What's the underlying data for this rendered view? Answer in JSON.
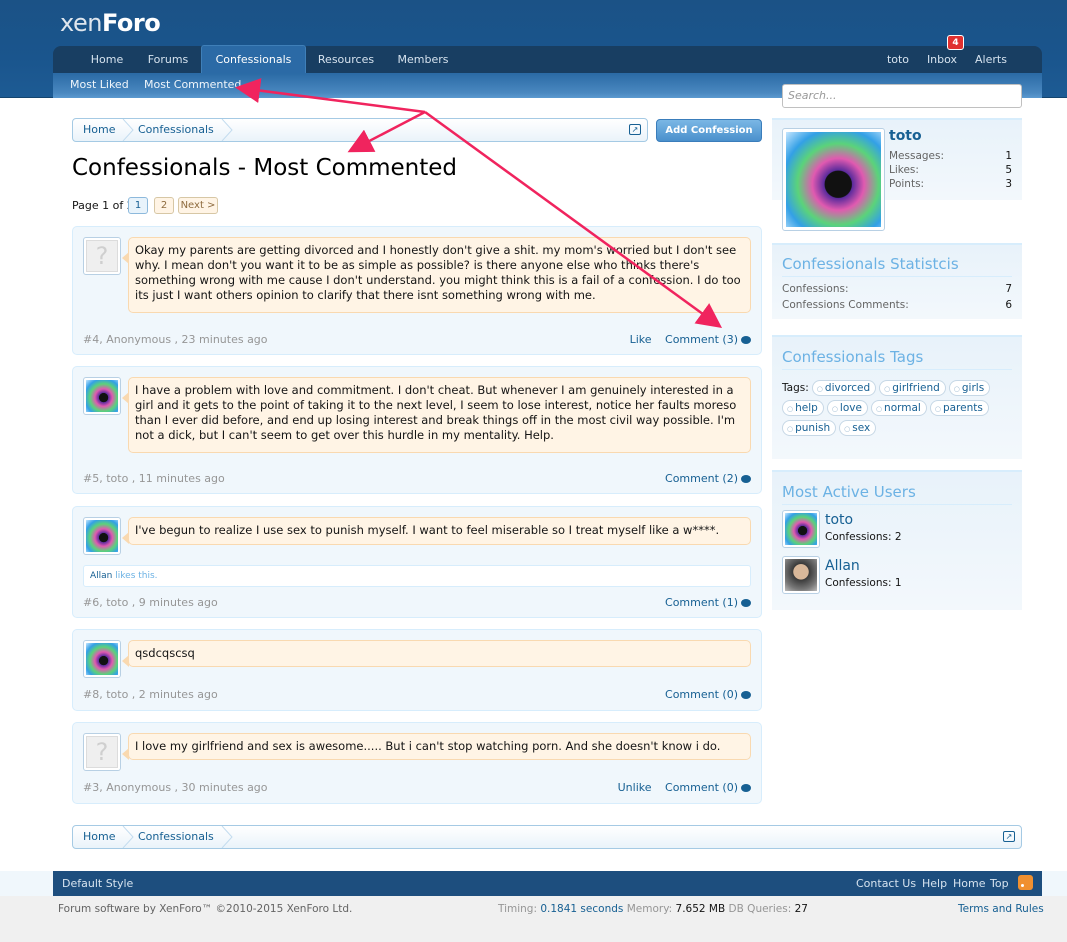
{
  "logo": {
    "xen": "xen",
    "foro": "Foro"
  },
  "nav": {
    "tabs": [
      "Home",
      "Forums",
      "Confessionals",
      "Resources",
      "Members"
    ],
    "user": "toto",
    "inbox": "Inbox",
    "inbox_count": "4",
    "alerts": "Alerts",
    "subtabs": [
      "Most Liked",
      "Most Commented"
    ]
  },
  "search": {
    "placeholder": "Search..."
  },
  "breadcrumb": [
    "Home",
    "Confessionals"
  ],
  "add_button": "Add Confession",
  "page_title": "Confessionals - Most Commented",
  "pagenav": {
    "label": "Page 1 of 2",
    "pages": [
      "1",
      "2"
    ],
    "next": "Next >"
  },
  "confessions": [
    {
      "text": "Okay my parents are getting divorced and I honestly don't give a shit. my mom's worried but I don't see why. I mean don't you want it to be as simple as possible? is there anyone else who thinks there's something wrong with me cause I don't understand. you might think this is a fail of a confession. I do too its just I want others opinion to clarify that there isnt something wrong with me.",
      "meta": "#4, Anonymous , 23 minutes ago",
      "like": "Like",
      "comment": "Comment (3)"
    },
    {
      "text": "I have a problem with love and commitment. I don't cheat. But whenever I am genuinely interested in a girl and it gets to the point of taking it to the next level, I seem to lose interest, notice her faults moreso than I ever did before, and end up losing interest and break things off in the most civil way possible. I'm not a dick, but I can't seem to get over this hurdle in my mentality. Help.",
      "meta": "#5, toto , 11 minutes ago",
      "comment": "Comment (2)"
    },
    {
      "text": "I've begun to realize I use sex to punish myself. I want to feel miserable so I treat myself like a w****.",
      "liker": "Allan",
      "likes_text": "likes this.",
      "meta": "#6, toto , 9 minutes ago",
      "comment": "Comment (1)"
    },
    {
      "text": "qsdcqscsq",
      "meta": "#8, toto , 2 minutes ago",
      "comment": "Comment (0)"
    },
    {
      "text": "I love my girlfriend and sex is awesome..... But i can't stop watching porn. And she doesn't know i do.",
      "meta": "#3, Anonymous , 30 minutes ago",
      "unlike": "Unlike",
      "comment": "Comment (0)"
    }
  ],
  "sidebar": {
    "profile": {
      "name": "toto",
      "stats": [
        {
          "label": "Messages:",
          "value": "1"
        },
        {
          "label": "Likes:",
          "value": "5"
        },
        {
          "label": "Points:",
          "value": "3"
        }
      ]
    },
    "statistics": {
      "heading": "Confessionals Statistcis",
      "rows": [
        {
          "label": "Confessions:",
          "value": "7"
        },
        {
          "label": "Confessions Comments:",
          "value": "6"
        }
      ]
    },
    "tags": {
      "heading": "Confessionals Tags",
      "label": "Tags:",
      "items": [
        "divorced",
        "girlfriend",
        "girls",
        "help",
        "love",
        "normal",
        "parents",
        "punish",
        "sex"
      ]
    },
    "active_users": {
      "heading": "Most Active Users",
      "users": [
        {
          "name": "toto",
          "info": "Confessions: 2"
        },
        {
          "name": "Allan",
          "info": "Confessions: 1"
        }
      ]
    }
  },
  "footer": {
    "style": "Default Style",
    "links": [
      "Contact Us",
      "Help",
      "Home",
      "Top"
    ],
    "copyright": "Forum software by XenForo™ ©2010-2015 XenForo Ltd.",
    "timing_label": "Timing:",
    "timing_value": "0.1841 seconds",
    "memory_label": "Memory:",
    "memory_value": "7.652 MB",
    "db_label": "DB Queries:",
    "db_value": "27",
    "terms": "Terms and Rules"
  },
  "colors": {
    "annotation_arrow": "#f0245e",
    "header_blue": "#1b5286",
    "link": "#176093"
  }
}
